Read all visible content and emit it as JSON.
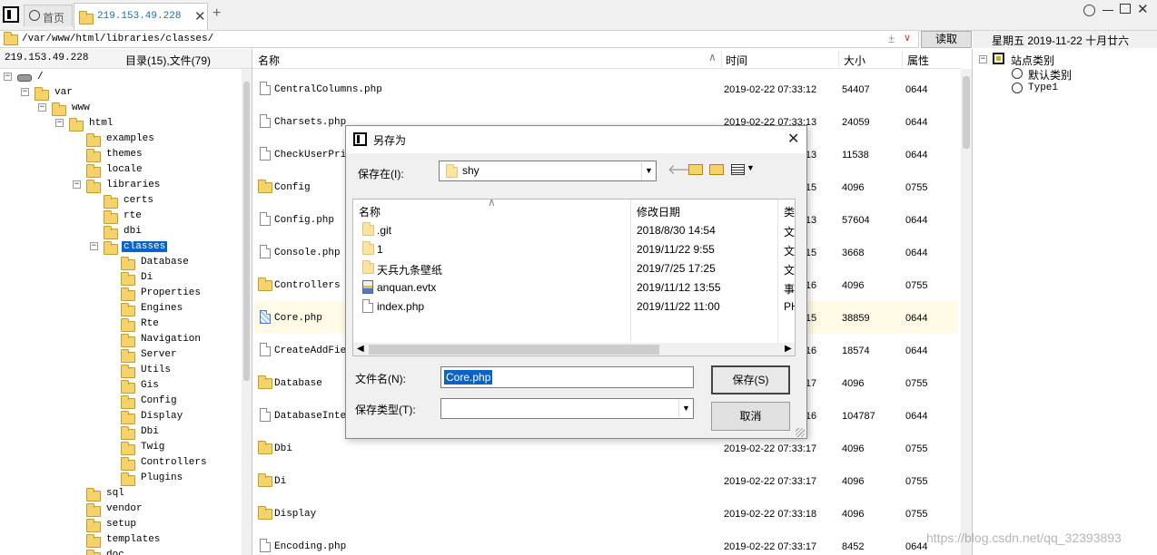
{
  "tabs": [
    {
      "label": "首页"
    },
    {
      "label": "219.153.49.228"
    }
  ],
  "address": {
    "path": "/var/www/html/libraries/classes/",
    "read_label": "读取",
    "date": "星期五 2019-11-22 十月廿六"
  },
  "tree": {
    "host": "219.153.49.228",
    "count": "目录(15),文件(79)",
    "items": [
      {
        "label": "/",
        "depth": 0,
        "toggle": "⊟"
      },
      {
        "label": "var",
        "depth": 1,
        "toggle": "⊟"
      },
      {
        "label": "www",
        "depth": 2,
        "toggle": "⊟"
      },
      {
        "label": "html",
        "depth": 3,
        "toggle": "⊟"
      },
      {
        "label": "examples",
        "depth": 4
      },
      {
        "label": "themes",
        "depth": 4
      },
      {
        "label": "locale",
        "depth": 4
      },
      {
        "label": "libraries",
        "depth": 4,
        "toggle": "⊟"
      },
      {
        "label": "certs",
        "depth": 5
      },
      {
        "label": "rte",
        "depth": 5
      },
      {
        "label": "dbi",
        "depth": 5
      },
      {
        "label": "classes",
        "depth": 5,
        "toggle": "⊟",
        "selected": true
      },
      {
        "label": "Database",
        "depth": 6
      },
      {
        "label": "Di",
        "depth": 6
      },
      {
        "label": "Properties",
        "depth": 6
      },
      {
        "label": "Engines",
        "depth": 6
      },
      {
        "label": "Rte",
        "depth": 6
      },
      {
        "label": "Navigation",
        "depth": 6
      },
      {
        "label": "Server",
        "depth": 6
      },
      {
        "label": "Utils",
        "depth": 6
      },
      {
        "label": "Gis",
        "depth": 6
      },
      {
        "label": "Config",
        "depth": 6
      },
      {
        "label": "Display",
        "depth": 6
      },
      {
        "label": "Dbi",
        "depth": 6
      },
      {
        "label": "Twig",
        "depth": 6
      },
      {
        "label": "Controllers",
        "depth": 6
      },
      {
        "label": "Plugins",
        "depth": 6
      },
      {
        "label": "sql",
        "depth": 4
      },
      {
        "label": "vendor",
        "depth": 4
      },
      {
        "label": "setup",
        "depth": 4
      },
      {
        "label": "templates",
        "depth": 4
      },
      {
        "label": "doc",
        "depth": 4
      }
    ]
  },
  "files": {
    "headers": {
      "name": "名称",
      "time": "时间",
      "size": "大小",
      "attr": "属性"
    },
    "rows": [
      {
        "name": "CentralColumns.php",
        "time": "2019-02-22 07:33:12",
        "size": "54407",
        "attr": "0644",
        "type": "file"
      },
      {
        "name": "Charsets.php",
        "time": "2019-02-22 07:33:13",
        "size": "24059",
        "attr": "0644",
        "type": "file"
      },
      {
        "name": "CheckUserPrivileges.php",
        "time": "2019-02-22 07:33:13",
        "size": "11538",
        "attr": "0644",
        "type": "file"
      },
      {
        "name": "Config",
        "time": "2019-02-22 07:33:15",
        "size": "4096",
        "attr": "0755",
        "type": "folder"
      },
      {
        "name": "Config.php",
        "time": "2019-02-22 07:33:13",
        "size": "57604",
        "attr": "0644",
        "type": "file"
      },
      {
        "name": "Console.php",
        "time": "2019-02-22 07:33:15",
        "size": "3668",
        "attr": "0644",
        "type": "file"
      },
      {
        "name": "Controllers",
        "time": "2019-02-22 07:33:16",
        "size": "4096",
        "attr": "0755",
        "type": "folder"
      },
      {
        "name": "Core.php",
        "time": "2019-02-22 07:33:15",
        "size": "38859",
        "attr": "0644",
        "type": "file",
        "highlight": true
      },
      {
        "name": "CreateAddField.php",
        "time": "2019-02-22 07:33:16",
        "size": "18574",
        "attr": "0644",
        "type": "file"
      },
      {
        "name": "Database",
        "time": "2019-02-22 07:33:17",
        "size": "4096",
        "attr": "0755",
        "type": "folder"
      },
      {
        "name": "DatabaseInterface.php",
        "time": "2019-02-22 07:33:16",
        "size": "104787",
        "attr": "0644",
        "type": "file"
      },
      {
        "name": "Dbi",
        "time": "2019-02-22 07:33:17",
        "size": "4096",
        "attr": "0755",
        "type": "folder"
      },
      {
        "name": "Di",
        "time": "2019-02-22 07:33:17",
        "size": "4096",
        "attr": "0755",
        "type": "folder"
      },
      {
        "name": "Display",
        "time": "2019-02-22 07:33:18",
        "size": "4096",
        "attr": "0755",
        "type": "folder"
      },
      {
        "name": "Encoding.php",
        "time": "2019-02-22 07:33:17",
        "size": "8452",
        "attr": "0644",
        "type": "file"
      }
    ]
  },
  "categories": {
    "root": "站点类别",
    "items": [
      "默认类别",
      "Type1"
    ]
  },
  "watermark": "https://blog.csdn.net/qq_32393893",
  "dialog": {
    "title": "另存为",
    "save_in_label": "保存在(I):",
    "save_in_value": "shy",
    "col_name": "名称",
    "col_date": "修改日期",
    "col_type": "类",
    "items": [
      {
        "name": ".git",
        "date": "2018/8/30 14:54",
        "type": "文",
        "icon": "folder"
      },
      {
        "name": "1",
        "date": "2019/11/22 9:55",
        "type": "文",
        "icon": "folder"
      },
      {
        "name": "天兵九条壁纸",
        "date": "2019/7/25 17:25",
        "type": "文",
        "icon": "folder"
      },
      {
        "name": "anquan.evtx",
        "date": "2019/11/12 13:55",
        "type": "事",
        "icon": "evtx"
      },
      {
        "name": "index.php",
        "date": "2019/11/22 11:00",
        "type": "PH",
        "icon": "file"
      }
    ],
    "filename_label": "文件名(N):",
    "filename_value": "Core.php",
    "filetype_label": "保存类型(T):",
    "filetype_value": "",
    "save_btn": "保存(S)",
    "cancel_btn": "取消"
  }
}
